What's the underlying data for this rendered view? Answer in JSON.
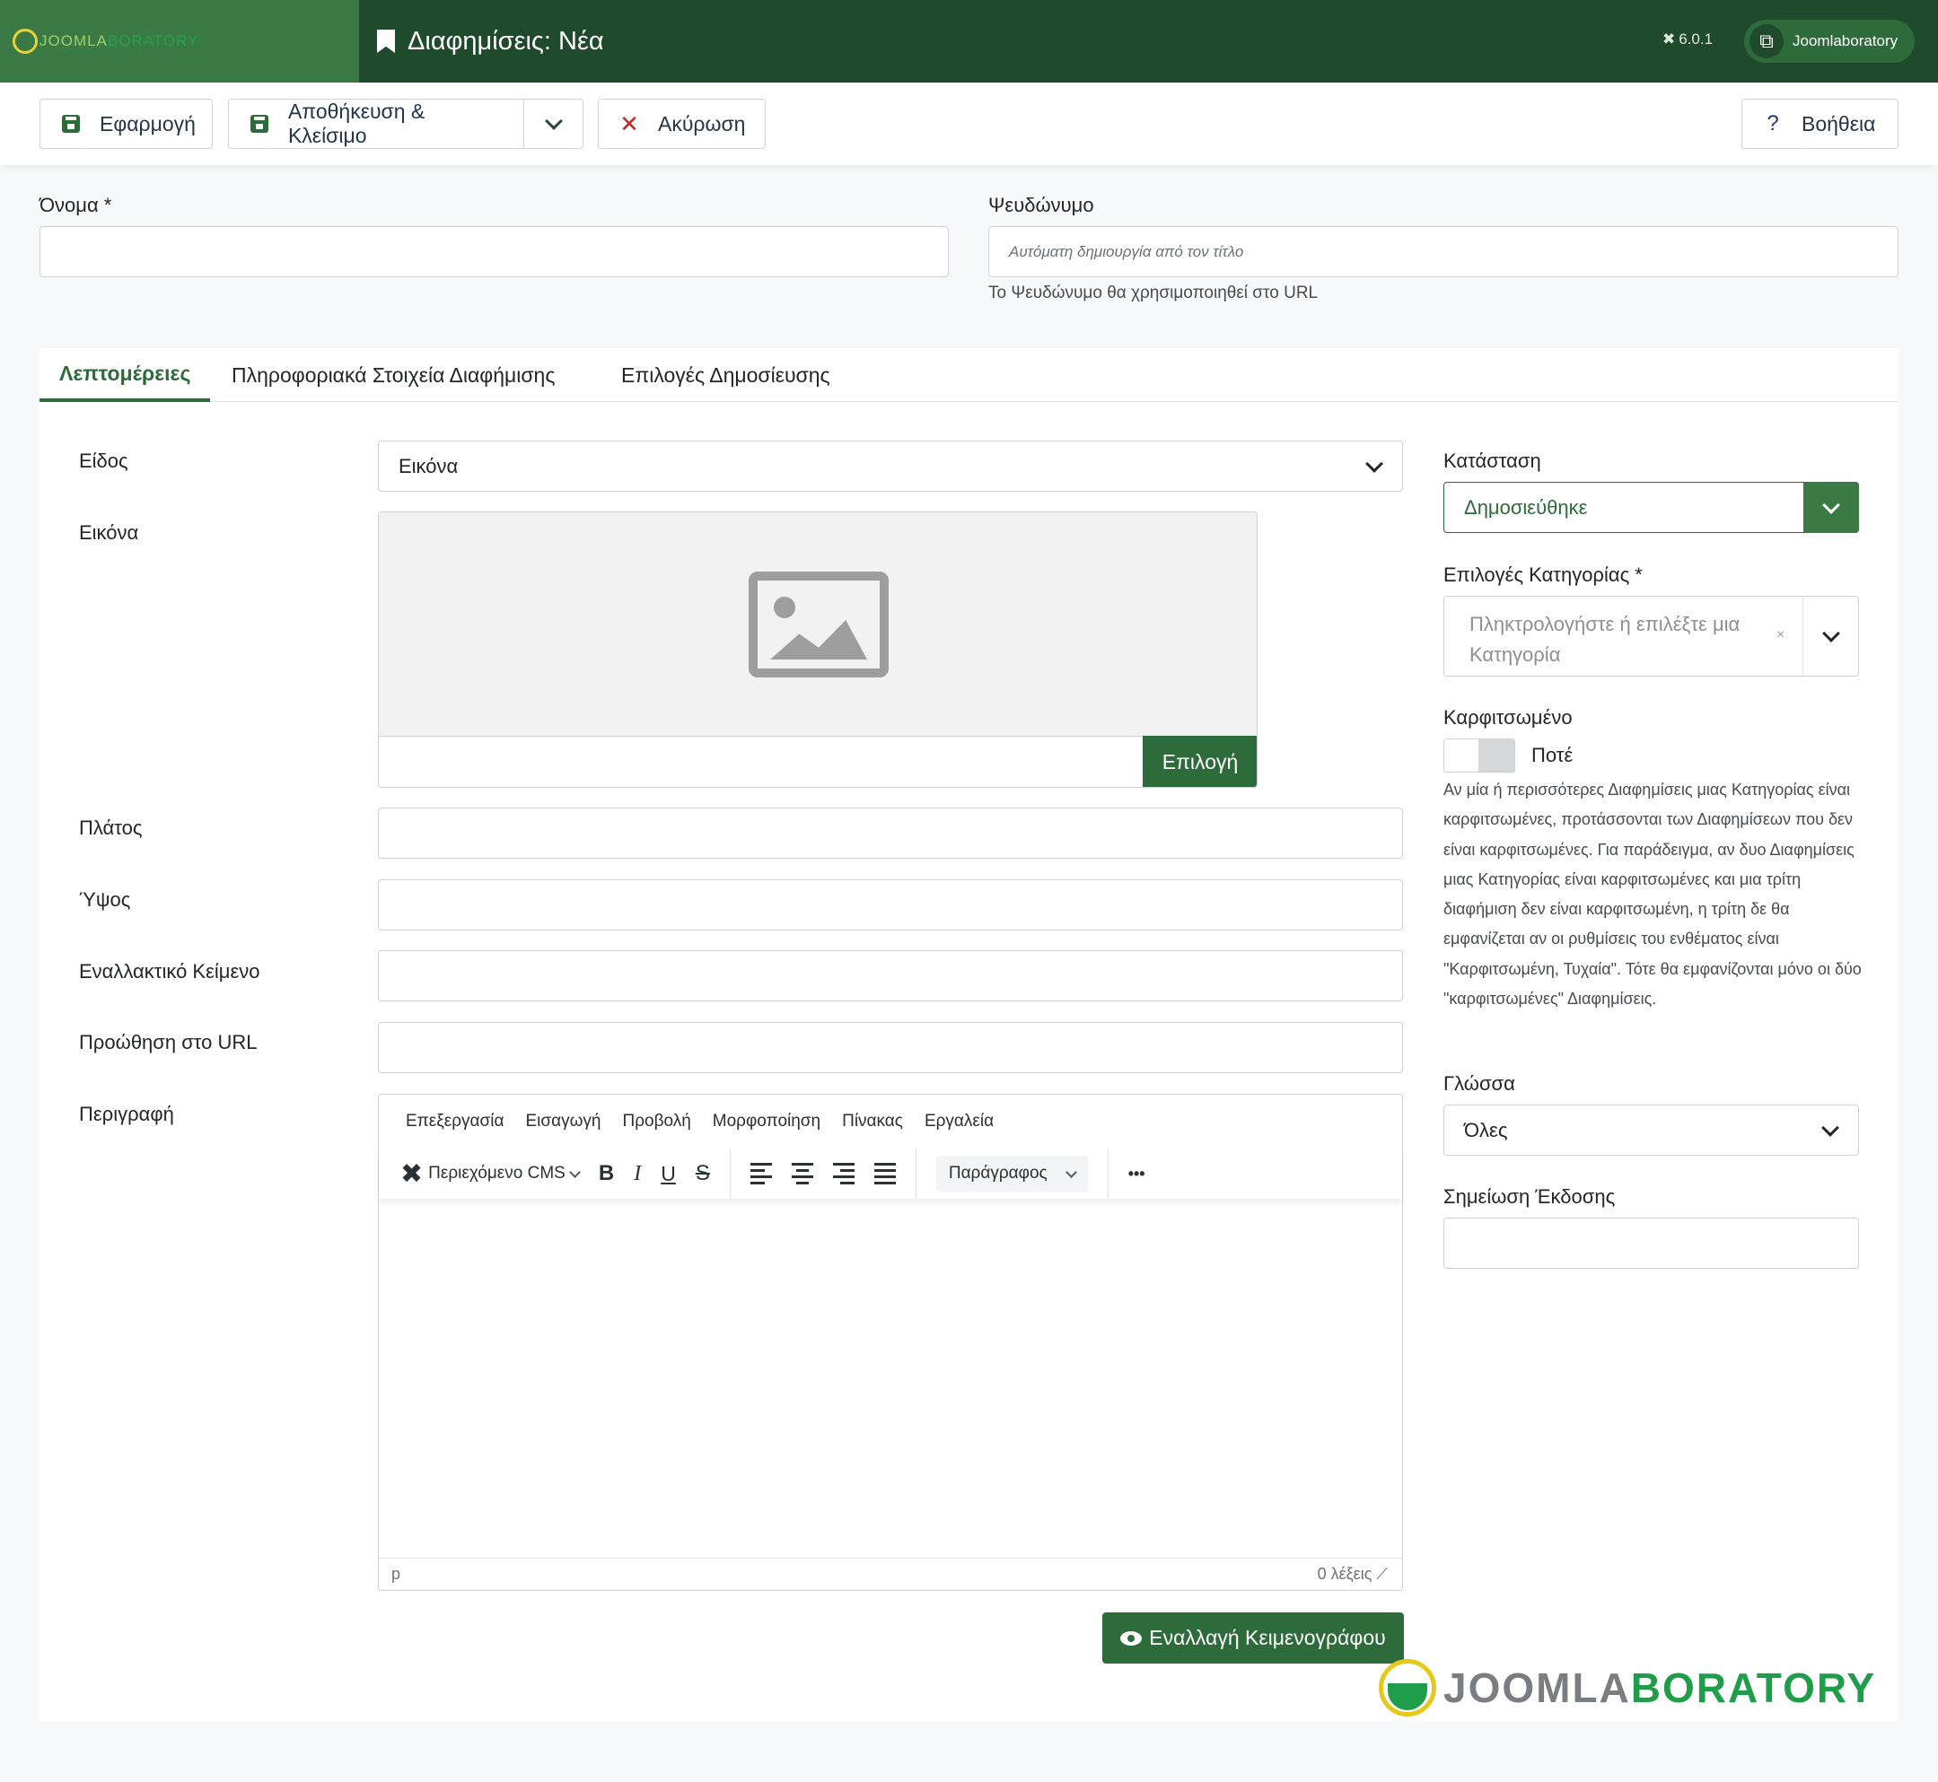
{
  "header": {
    "brand_prefix": "JOOMLA",
    "brand_suffix": "BORATORY",
    "title": "Διαφημίσεις: Νέα",
    "version": "6.0.1",
    "user_label": "Joomlaboratory"
  },
  "toolbar": {
    "apply_label": "Εφαρμογή",
    "save_close_label": "Αποθήκευση & Κλείσιμο",
    "cancel_label": "Ακύρωση",
    "help_label": "Βοήθεια"
  },
  "top_fields": {
    "name_label": "Όνομα *",
    "name_value": "",
    "alias_label": "Ψευδώνυμο",
    "alias_placeholder": "Αυτόματη δημιουργία από τον τίτλο",
    "alias_help": "Το Ψευδώνυμο θα χρησιμοποιηθεί στο URL"
  },
  "tabs": [
    {
      "label": "Λεπτομέρειες",
      "active": true
    },
    {
      "label": "Πληροφοριακά Στοιχεία Διαφήμισης",
      "active": false
    },
    {
      "label": "Επιλογές Δημοσίευσης",
      "active": false
    }
  ],
  "details": {
    "type_label": "Είδος",
    "type_value": "Εικόνα",
    "image_label": "Εικόνα",
    "image_select_label": "Επιλογή",
    "width_label": "Πλάτος",
    "height_label": "Ύψος",
    "alt_label": "Εναλλακτικό Κείμενο",
    "url_label": "Προώθηση στο URL",
    "description_label": "Περιγραφή"
  },
  "editor": {
    "menu": [
      "Επεξεργασία",
      "Εισαγωγή",
      "Προβολή",
      "Μορφοποίηση",
      "Πίνακας",
      "Εργαλεία"
    ],
    "cms_content_label": "Περιεχόμενο CMS",
    "format_b": "B",
    "format_i": "I",
    "format_u": "U",
    "format_s": "S",
    "paragraph_label": "Παράγραφος",
    "more_label": "•••",
    "path": "p",
    "word_count": "0 λέξεις",
    "toggle_label": "Εναλλαγή Κειμενογράφου"
  },
  "sidebar": {
    "status_label": "Κατάσταση",
    "status_value": "Δημοσιεύθηκε",
    "category_label": "Επιλογές Κατηγορίας *",
    "category_placeholder": "Πληκτρολογήστε ή επιλέξτε μια Κατηγορία",
    "category_clear": "×",
    "pinned_label": "Καρφιτσωμένο",
    "pinned_value": "Ποτέ",
    "pinned_desc": "Αν μία ή περισσότερες Διαφημίσεις μιας Κατηγορίας είναι καρφιτσωμένες, προτάσσονται των Διαφημίσεων που δεν είναι καρφιτσωμένες. Για παράδειγμα, αν δυο Διαφημίσεις μιας Κατηγορίας είναι καρφιτσωμένες και μια τρίτη διαφήμιση δεν είναι καρφιτσωμένη, η τρίτη δε θα εμφανίζεται αν οι ρυθμίσεις του ενθέματος είναι \"Καρφιτσωμένη, Τυχαία\". Τότε θα εμφανίζονται μόνο οι δύο \"καρφιτσωμένες\" Διαφημίσεις.",
    "language_label": "Γλώσσα",
    "language_value": "Όλες",
    "version_note_label": "Σημείωση Έκδοσης"
  },
  "watermark": {
    "prefix": "JOOMLA",
    "suffix": "BORATORY"
  },
  "colors": {
    "header_bg": "#1f4a2b",
    "brand_bg": "#3c7a45",
    "accent": "#2e6b3b",
    "cancel_red": "#c52827"
  }
}
